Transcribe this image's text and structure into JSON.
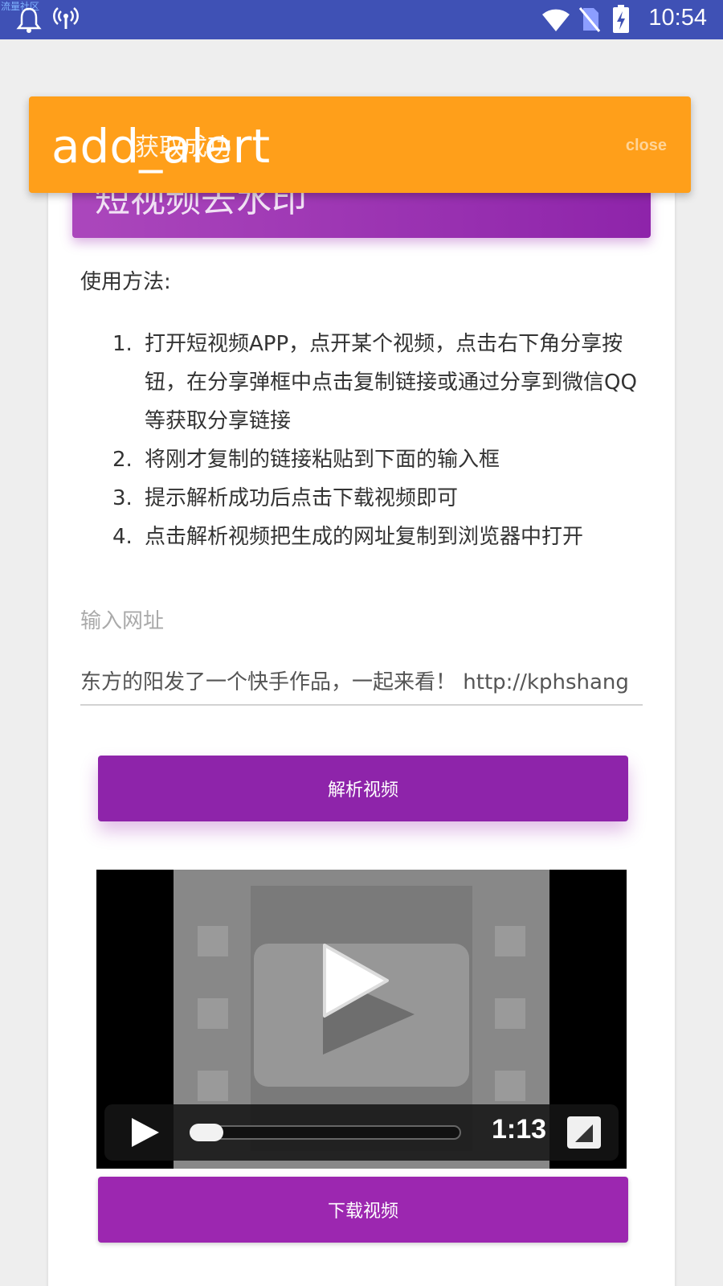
{
  "status_bar": {
    "tiny_label": "流量社区",
    "time": "10:54",
    "icons": [
      "qq-bell-icon",
      "hotspot-icon",
      "wifi-icon",
      "no-sim-icon",
      "battery-charging-icon"
    ]
  },
  "alert": {
    "icon_text": "add_alert",
    "message": "获取成功",
    "close_label": "close",
    "color": "#ff9f1a"
  },
  "card": {
    "header_title": "短视频去水印",
    "usage_title": "使用方法:",
    "steps": [
      {
        "num": "1.",
        "text": "打开短视频APP，点开某个视频，点击右下角分享按钮，在分享弹框中点击复制链接或通过分享到微信QQ等获取分享链接"
      },
      {
        "num": "2.",
        "text": "将刚才复制的链接粘贴到下面的输入框"
      },
      {
        "num": "3.",
        "text": "提示解析成功后点击下载视频即可"
      },
      {
        "num": "4.",
        "text": "点击解析视频把生成的网址复制到浏览器中打开"
      }
    ],
    "input_label": "输入网址",
    "input_value": "东方的阳发了一个快手作品，一起来看！ http://kphshang",
    "parse_button": "解析视频",
    "download_button": "下载视频",
    "accent_color": "#9c27b0"
  },
  "video": {
    "duration": "1:13",
    "progress": 0
  }
}
